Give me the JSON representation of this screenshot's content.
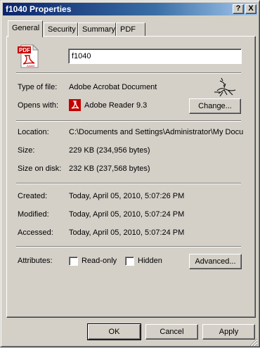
{
  "window": {
    "title": "f1040 Properties",
    "help_button": "?",
    "close_button": "X"
  },
  "tabs": [
    {
      "label": "General",
      "active": true
    },
    {
      "label": "Security",
      "active": false
    },
    {
      "label": "Summary",
      "active": false
    },
    {
      "label": "PDF",
      "active": false
    }
  ],
  "file": {
    "icon": "pdf-file-icon",
    "icon_text": "PDF",
    "icon_brand": "Adobe",
    "name": "f1040"
  },
  "details": {
    "type_label": "Type of file:",
    "type_value": "Adobe Acrobat Document",
    "opens_label": "Opens with:",
    "opens_value": "Adobe Reader 9.3",
    "change_button": "Change...",
    "location_label": "Location:",
    "location_value": "C:\\Documents and Settings\\Administrator\\My Documents",
    "size_label": "Size:",
    "size_value": "229 KB (234,956 bytes)",
    "size_on_disk_label": "Size on disk:",
    "size_on_disk_value": "232 KB (237,568 bytes)",
    "created_label": "Created:",
    "created_value": "Today, April 05, 2010, 5:07:26 PM",
    "modified_label": "Modified:",
    "modified_value": "Today, April 05, 2010, 5:07:24 PM",
    "accessed_label": "Accessed:",
    "accessed_value": "Today, April 05, 2010, 5:07:24 PM",
    "attributes_label": "Attributes:",
    "readonly_label": "Read-only",
    "readonly_checked": false,
    "hidden_label": "Hidden",
    "hidden_checked": false,
    "advanced_button": "Advanced..."
  },
  "footer": {
    "ok_button": "OK",
    "cancel_button": "Cancel",
    "apply_button": "Apply"
  },
  "colors": {
    "title_gradient_start": "#0a246a",
    "title_gradient_end": "#a6caf0",
    "face": "#d4d0c8",
    "pdf_red": "#cc0000"
  }
}
